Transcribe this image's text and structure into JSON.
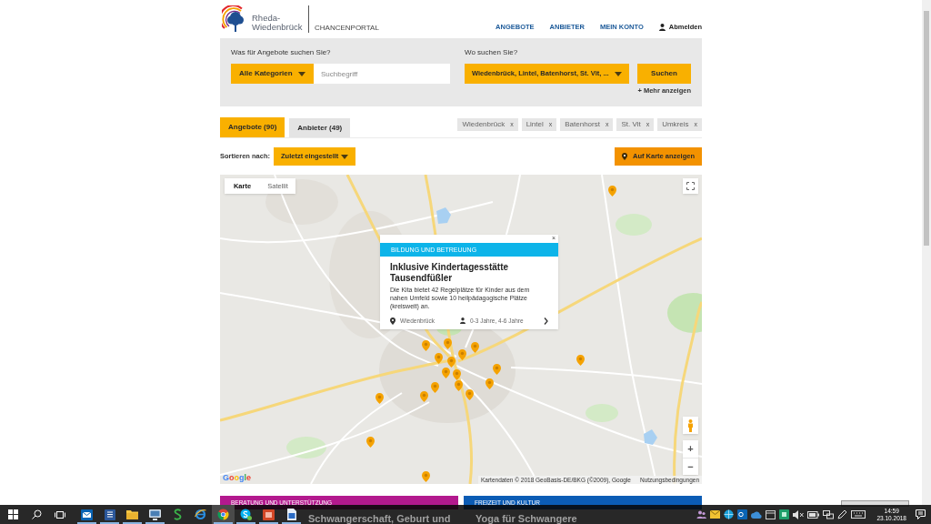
{
  "header": {
    "logo_text": "Rheda-Wiedenbrück",
    "portal": "CHANCENPORTAL",
    "nav": [
      {
        "label": "ANGEBOTE"
      },
      {
        "label": "ANBIETER"
      },
      {
        "label": "MEIN KONTO"
      }
    ],
    "logout": "Abmelden"
  },
  "search": {
    "what_label": "Was für Angebote suchen Sie?",
    "category": "Alle Kategorien",
    "keyword": {
      "placeholder": "Suchbegriff"
    },
    "where_label": "Wo suchen Sie?",
    "location": "Wiedenbrück, Lintel, Batenhorst, St. Vit, ...",
    "submit": "Suchen",
    "more": "+ Mehr anzeigen"
  },
  "tabs": [
    {
      "label": "Angebote (90)",
      "selected": true
    },
    {
      "label": "Anbieter (49)",
      "selected": false
    }
  ],
  "filters": [
    {
      "label": "Wiedenbrück",
      "remove": "x"
    },
    {
      "label": "Lintel",
      "remove": "x"
    },
    {
      "label": "Batenhorst",
      "remove": "x"
    },
    {
      "label": "St. Vit",
      "remove": "x"
    },
    {
      "label": "Umkreis",
      "remove": "x"
    }
  ],
  "sort": {
    "label": "Sortieren nach:",
    "value": "Zuletzt eingestellt"
  },
  "map_button": "Auf Karte anzeigen",
  "map": {
    "types": [
      {
        "label": "Karte",
        "selected": true
      },
      {
        "label": "Satellit",
        "selected": false
      }
    ],
    "popup": {
      "category": "BILDUNG UND BETREUUNG",
      "close": "×",
      "title": "Inklusive Kindertagesstätte Tausendfüßler",
      "description": "Die Kita bietet 42 Regelplätze für Kinder aus dem nahen Umfeld sowie 10 heilpädagogische Plätze (kreisweit) an.",
      "location": "Wiedenbrück",
      "ages": "0-3 Jahre, 4-6 Jahre"
    },
    "zoom_in": "+",
    "zoom_out": "−",
    "logo": "Google",
    "attribution": "Kartendaten © 2018 GeoBasis-DE/BKG (©2009), Google",
    "terms": "Nutzungsbedingungen"
  },
  "cards": [
    {
      "category": "BERATUNG UND UNTERSTÜTZUNG",
      "color": "#b3198e",
      "title": "Schwangerschaft, Geburt und"
    },
    {
      "category": "FREIZEIT UND KULTUR",
      "color": "#0b5cb5",
      "title": "Yoga für Schwangere"
    }
  ],
  "taskbar": {
    "apps": [
      {
        "kind": "mail",
        "running": true,
        "selected": false
      },
      {
        "kind": "word",
        "running": true,
        "selected": false
      },
      {
        "kind": "folder",
        "running": true,
        "selected": false
      },
      {
        "kind": "monitor",
        "running": true,
        "selected": false
      },
      {
        "kind": "s-app",
        "running": false,
        "selected": false
      },
      {
        "kind": "edge",
        "running": false,
        "selected": false
      },
      {
        "kind": "chrome",
        "running": true,
        "selected": true
      },
      {
        "kind": "skype",
        "running": true,
        "selected": false
      },
      {
        "kind": "powerpoint",
        "running": true,
        "selected": false
      },
      {
        "kind": "document",
        "running": true,
        "selected": false
      }
    ],
    "time": "14:59",
    "date": "23.10.2018"
  }
}
